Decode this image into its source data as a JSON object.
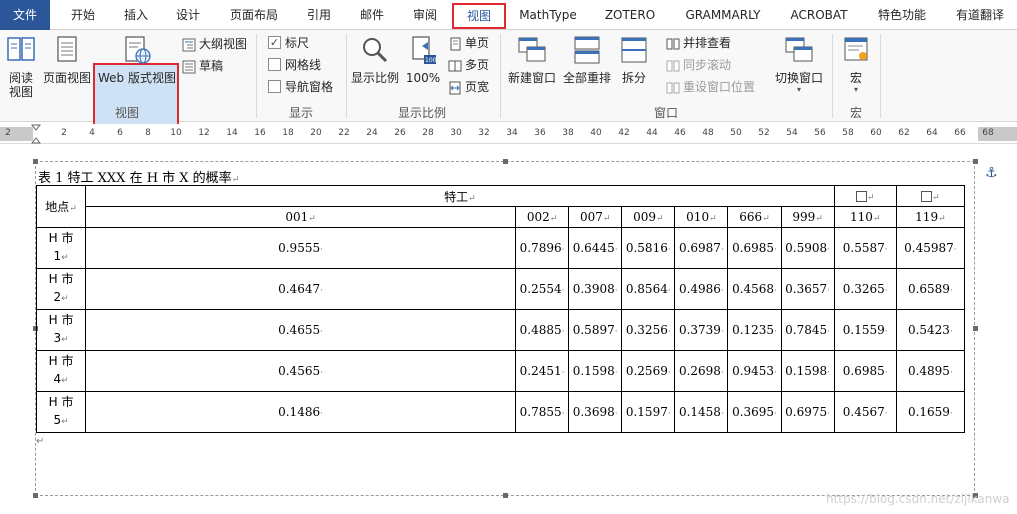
{
  "menu": {
    "tabs": [
      "文件",
      "开始",
      "插入",
      "设计",
      "页面布局",
      "引用",
      "邮件",
      "审阅",
      "视图",
      "MathType",
      "ZOTERO",
      "GRAMMARLY",
      "ACROBAT",
      "特色功能",
      "有道翻译"
    ]
  },
  "ribbon": {
    "views": {
      "read": "阅读\n视图",
      "print": "页面视图",
      "web": "Web 版式视图",
      "outline": "大纲视图",
      "draft": "草稿",
      "group": "视图"
    },
    "show": {
      "ruler": "标尺",
      "gridlines": "网格线",
      "navpane": "导航窗格",
      "group": "显示"
    },
    "zoom": {
      "zoom": "显示比例",
      "hundred": "100%",
      "one_page": "单页",
      "multi_page": "多页",
      "page_width": "页宽",
      "group": "显示比例"
    },
    "window": {
      "new_window": "新建窗口",
      "arrange_all": "全部重排",
      "split": "拆分",
      "side_by_side": "并排查看",
      "sync_scroll": "同步滚动",
      "reset_pos": "重设窗口位置",
      "switch": "切换窗口",
      "group": "窗口"
    },
    "macro": {
      "macro": "宏",
      "group": "宏"
    }
  },
  "ruler": {
    "ticks": [
      "2",
      "2",
      "4",
      "6",
      "8",
      "10",
      "12",
      "14",
      "16",
      "18",
      "20",
      "22",
      "24",
      "26",
      "28",
      "30",
      "32",
      "34",
      "36",
      "38",
      "40",
      "42",
      "44",
      "46",
      "48",
      "50",
      "52",
      "54",
      "56",
      "58",
      "60",
      "62",
      "64",
      "66",
      "68"
    ]
  },
  "document": {
    "caption": "表 1  特工 XXX 在 H 市 X 的概率",
    "table": {
      "corner": "地点",
      "group_header": "特工",
      "columns": [
        "001",
        "002",
        "007",
        "009",
        "010",
        "666",
        "999",
        "110",
        "119"
      ],
      "rows": [
        {
          "place": "H 市\n1",
          "values": [
            "0.9555",
            "0.7896",
            "0.6445",
            "0.5816",
            "0.6987",
            "0.6985",
            "0.5908",
            "0.5587",
            "0.45987"
          ]
        },
        {
          "place": "H 市\n2",
          "values": [
            "0.4647",
            "0.2554",
            "0.3908",
            "0.8564",
            "0.4986",
            "0.4568",
            "0.3657",
            "0.3265",
            "0.6589"
          ]
        },
        {
          "place": "H 市\n3",
          "values": [
            "0.4655",
            "0.4885",
            "0.5897",
            "0.3256",
            "0.3739",
            "0.1235",
            "0.7845",
            "0.1559",
            "0.5423"
          ]
        },
        {
          "place": "H 市\n4",
          "values": [
            "0.4565",
            "0.2451",
            "0.1598",
            "0.2569",
            "0.2698",
            "0.9453",
            "0.1598",
            "0.6985",
            "0.4895"
          ]
        },
        {
          "place": "H 市\n5",
          "values": [
            "0.1486",
            "0.7855",
            "0.3698",
            "0.1597",
            "0.1458",
            "0.3695",
            "0.6975",
            "0.4567",
            "0.1659"
          ]
        }
      ]
    },
    "watermark": "https://blog.csdn.net/zijikanwa"
  }
}
